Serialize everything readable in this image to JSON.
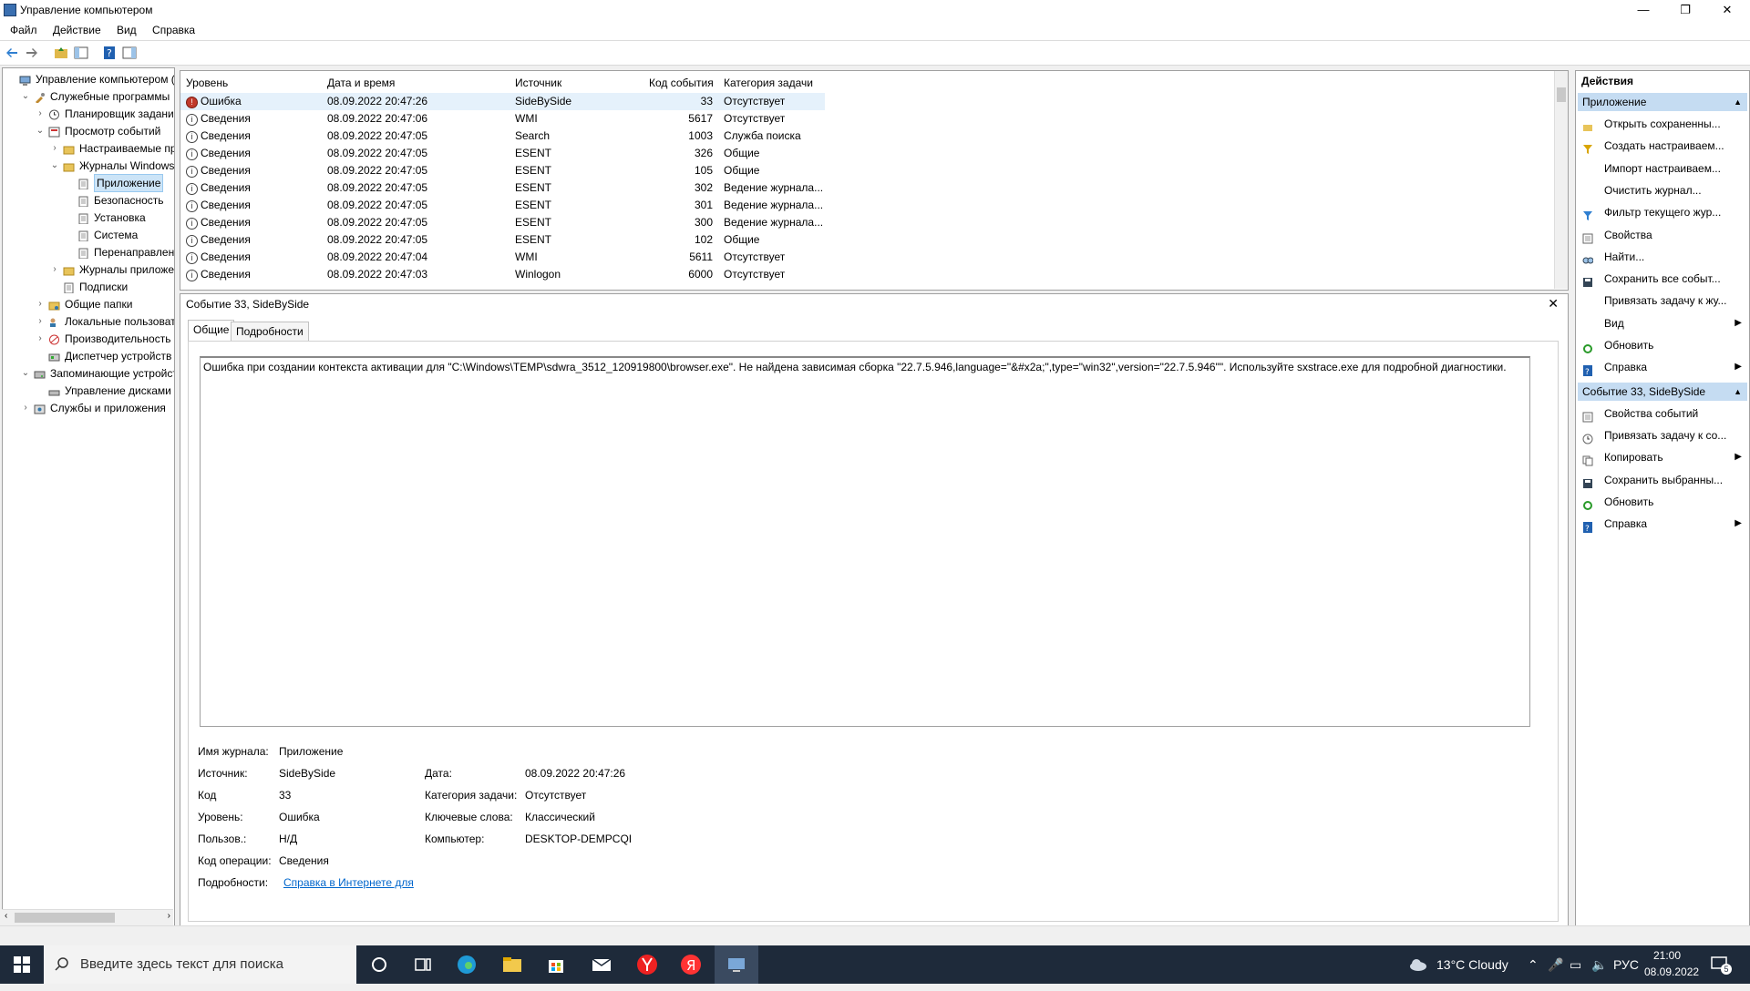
{
  "window": {
    "title": "Управление компьютером",
    "controls": {
      "minimize": "—",
      "restore": "❐",
      "close": "✕"
    }
  },
  "menu": [
    "Файл",
    "Действие",
    "Вид",
    "Справка"
  ],
  "tree": [
    {
      "label": "Управление компьютером (л",
      "indent": 0,
      "exp": "",
      "icon": "computer-icon"
    },
    {
      "label": "Служебные программы",
      "indent": 1,
      "exp": "⌄",
      "icon": "tools-icon"
    },
    {
      "label": "Планировщик заданий",
      "indent": 2,
      "exp": "›",
      "icon": "clock-icon"
    },
    {
      "label": "Просмотр событий",
      "indent": 2,
      "exp": "⌄",
      "icon": "event-viewer-icon"
    },
    {
      "label": "Настраиваемые пр",
      "indent": 3,
      "exp": "›",
      "icon": "folder-icon"
    },
    {
      "label": "Журналы Windows",
      "indent": 3,
      "exp": "⌄",
      "icon": "folder-icon"
    },
    {
      "label": "Приложение",
      "indent": 4,
      "exp": "",
      "icon": "log-icon",
      "selected": true
    },
    {
      "label": "Безопасность",
      "indent": 4,
      "exp": "",
      "icon": "log-icon"
    },
    {
      "label": "Установка",
      "indent": 4,
      "exp": "",
      "icon": "log-icon"
    },
    {
      "label": "Система",
      "indent": 4,
      "exp": "",
      "icon": "log-icon"
    },
    {
      "label": "Перенаправлен",
      "indent": 4,
      "exp": "",
      "icon": "log-icon"
    },
    {
      "label": "Журналы приложе",
      "indent": 3,
      "exp": "›",
      "icon": "folder-icon"
    },
    {
      "label": "Подписки",
      "indent": 3,
      "exp": "",
      "icon": "log-icon"
    },
    {
      "label": "Общие папки",
      "indent": 2,
      "exp": "›",
      "icon": "shared-folder-icon"
    },
    {
      "label": "Локальные пользовате",
      "indent": 2,
      "exp": "›",
      "icon": "users-icon"
    },
    {
      "label": "Производительность",
      "indent": 2,
      "exp": "›",
      "icon": "performance-icon"
    },
    {
      "label": "Диспетчер устройств",
      "indent": 2,
      "exp": "",
      "icon": "device-manager-icon"
    },
    {
      "label": "Запоминающие устройст",
      "indent": 1,
      "exp": "⌄",
      "icon": "storage-icon"
    },
    {
      "label": "Управление дисками",
      "indent": 2,
      "exp": "",
      "icon": "disk-icon"
    },
    {
      "label": "Службы и приложения",
      "indent": 1,
      "exp": "›",
      "icon": "services-icon"
    }
  ],
  "list": {
    "columns": [
      "Уровень",
      "Дата и время",
      "Источник",
      "Код события",
      "Категория задачи"
    ],
    "rows": [
      {
        "level": "Ошибка",
        "type": "error",
        "date": "08.09.2022 20:47:26",
        "source": "SideBySide",
        "code": "33",
        "category": "Отсутствует"
      },
      {
        "level": "Сведения",
        "type": "info",
        "date": "08.09.2022 20:47:06",
        "source": "WMI",
        "code": "5617",
        "category": "Отсутствует"
      },
      {
        "level": "Сведения",
        "type": "info",
        "date": "08.09.2022 20:47:05",
        "source": "Search",
        "code": "1003",
        "category": "Служба поиска"
      },
      {
        "level": "Сведения",
        "type": "info",
        "date": "08.09.2022 20:47:05",
        "source": "ESENT",
        "code": "326",
        "category": "Общие"
      },
      {
        "level": "Сведения",
        "type": "info",
        "date": "08.09.2022 20:47:05",
        "source": "ESENT",
        "code": "105",
        "category": "Общие"
      },
      {
        "level": "Сведения",
        "type": "info",
        "date": "08.09.2022 20:47:05",
        "source": "ESENT",
        "code": "302",
        "category": "Ведение журнала..."
      },
      {
        "level": "Сведения",
        "type": "info",
        "date": "08.09.2022 20:47:05",
        "source": "ESENT",
        "code": "301",
        "category": "Ведение журнала..."
      },
      {
        "level": "Сведения",
        "type": "info",
        "date": "08.09.2022 20:47:05",
        "source": "ESENT",
        "code": "300",
        "category": "Ведение журнала..."
      },
      {
        "level": "Сведения",
        "type": "info",
        "date": "08.09.2022 20:47:05",
        "source": "ESENT",
        "code": "102",
        "category": "Общие"
      },
      {
        "level": "Сведения",
        "type": "info",
        "date": "08.09.2022 20:47:04",
        "source": "WMI",
        "code": "5611",
        "category": "Отсутствует"
      },
      {
        "level": "Сведения",
        "type": "info",
        "date": "08.09.2022 20:47:03",
        "source": "Winlogon",
        "code": "6000",
        "category": "Отсутствует"
      }
    ]
  },
  "detail": {
    "title": "Событие 33, SideBySide",
    "close": "✕",
    "tabs": [
      "Общие",
      "Подробности"
    ],
    "message": "Ошибка при создании контекста активации для \"C:\\Windows\\TEMP\\sdwra_3512_120919800\\browser.exe\". Не найдена зависимая сборка \"22.7.5.946,language=\"&#x2a;\",type=\"win32\",version=\"22.7.5.946\"\". Используйте sxstrace.exe для подробной диагностики.",
    "fields": {
      "log_name_label": "Имя журнала:",
      "log_name": "Приложение",
      "source_label": "Источник:",
      "source": "SideBySide",
      "date_label": "Дата:",
      "date": "08.09.2022 20:47:26",
      "code_label": "Код",
      "code": "33",
      "task_label": "Категория задачи:",
      "task": "Отсутствует",
      "level_label": "Уровень:",
      "level": "Ошибка",
      "keywords_label": "Ключевые слова:",
      "keywords": "Классический",
      "user_label": "Пользов.:",
      "user": "Н/Д",
      "computer_label": "Компьютер:",
      "computer": "DESKTOP-DEMPCQI",
      "opcode_label": "Код операции:",
      "opcode": "Сведения",
      "more_label": "Подробности:",
      "more_link": "Справка в Интернете для "
    }
  },
  "actions": {
    "header": "Действия",
    "sections": [
      {
        "title": "Приложение",
        "items": [
          {
            "label": "Открыть сохраненны...",
            "icon": "open-folder-icon"
          },
          {
            "label": "Создать настраиваем...",
            "icon": "filter-create-icon"
          },
          {
            "label": "Импорт настраиваем...",
            "icon": ""
          },
          {
            "label": "Очистить журнал...",
            "icon": ""
          },
          {
            "label": "Фильтр текущего жур...",
            "icon": "filter-icon"
          },
          {
            "label": "Свойства",
            "icon": "properties-icon"
          },
          {
            "label": "Найти...",
            "icon": "find-icon"
          },
          {
            "label": "Сохранить все событ...",
            "icon": "save-icon"
          },
          {
            "label": "Привязать задачу к жу...",
            "icon": ""
          },
          {
            "label": "Вид",
            "icon": "",
            "submenu": "▶"
          },
          {
            "label": "Обновить",
            "icon": "refresh-icon"
          },
          {
            "label": "Справка",
            "icon": "help-icon",
            "submenu": "▶"
          }
        ]
      },
      {
        "title": "Событие 33, SideBySide",
        "items": [
          {
            "label": "Свойства событий",
            "icon": "properties-icon"
          },
          {
            "label": "Привязать задачу к со...",
            "icon": "task-icon"
          },
          {
            "label": "Копировать",
            "icon": "copy-icon",
            "submenu": "▶"
          },
          {
            "label": "Сохранить выбранны...",
            "icon": "save-icon"
          },
          {
            "label": "Обновить",
            "icon": "refresh-icon"
          },
          {
            "label": "Справка",
            "icon": "help-icon",
            "submenu": "▶"
          }
        ]
      }
    ]
  },
  "taskbar": {
    "search_placeholder": "Введите здесь текст для поиска",
    "weather": "13°C  Cloudy",
    "lang": "РУС",
    "time": "21:00",
    "date": "08.09.2022",
    "notif_count": "5"
  },
  "colors": {
    "accent": "#0078d7",
    "section": "#c5dcf2",
    "error": "#c0392b",
    "taskbar": "#1e2a3a"
  }
}
